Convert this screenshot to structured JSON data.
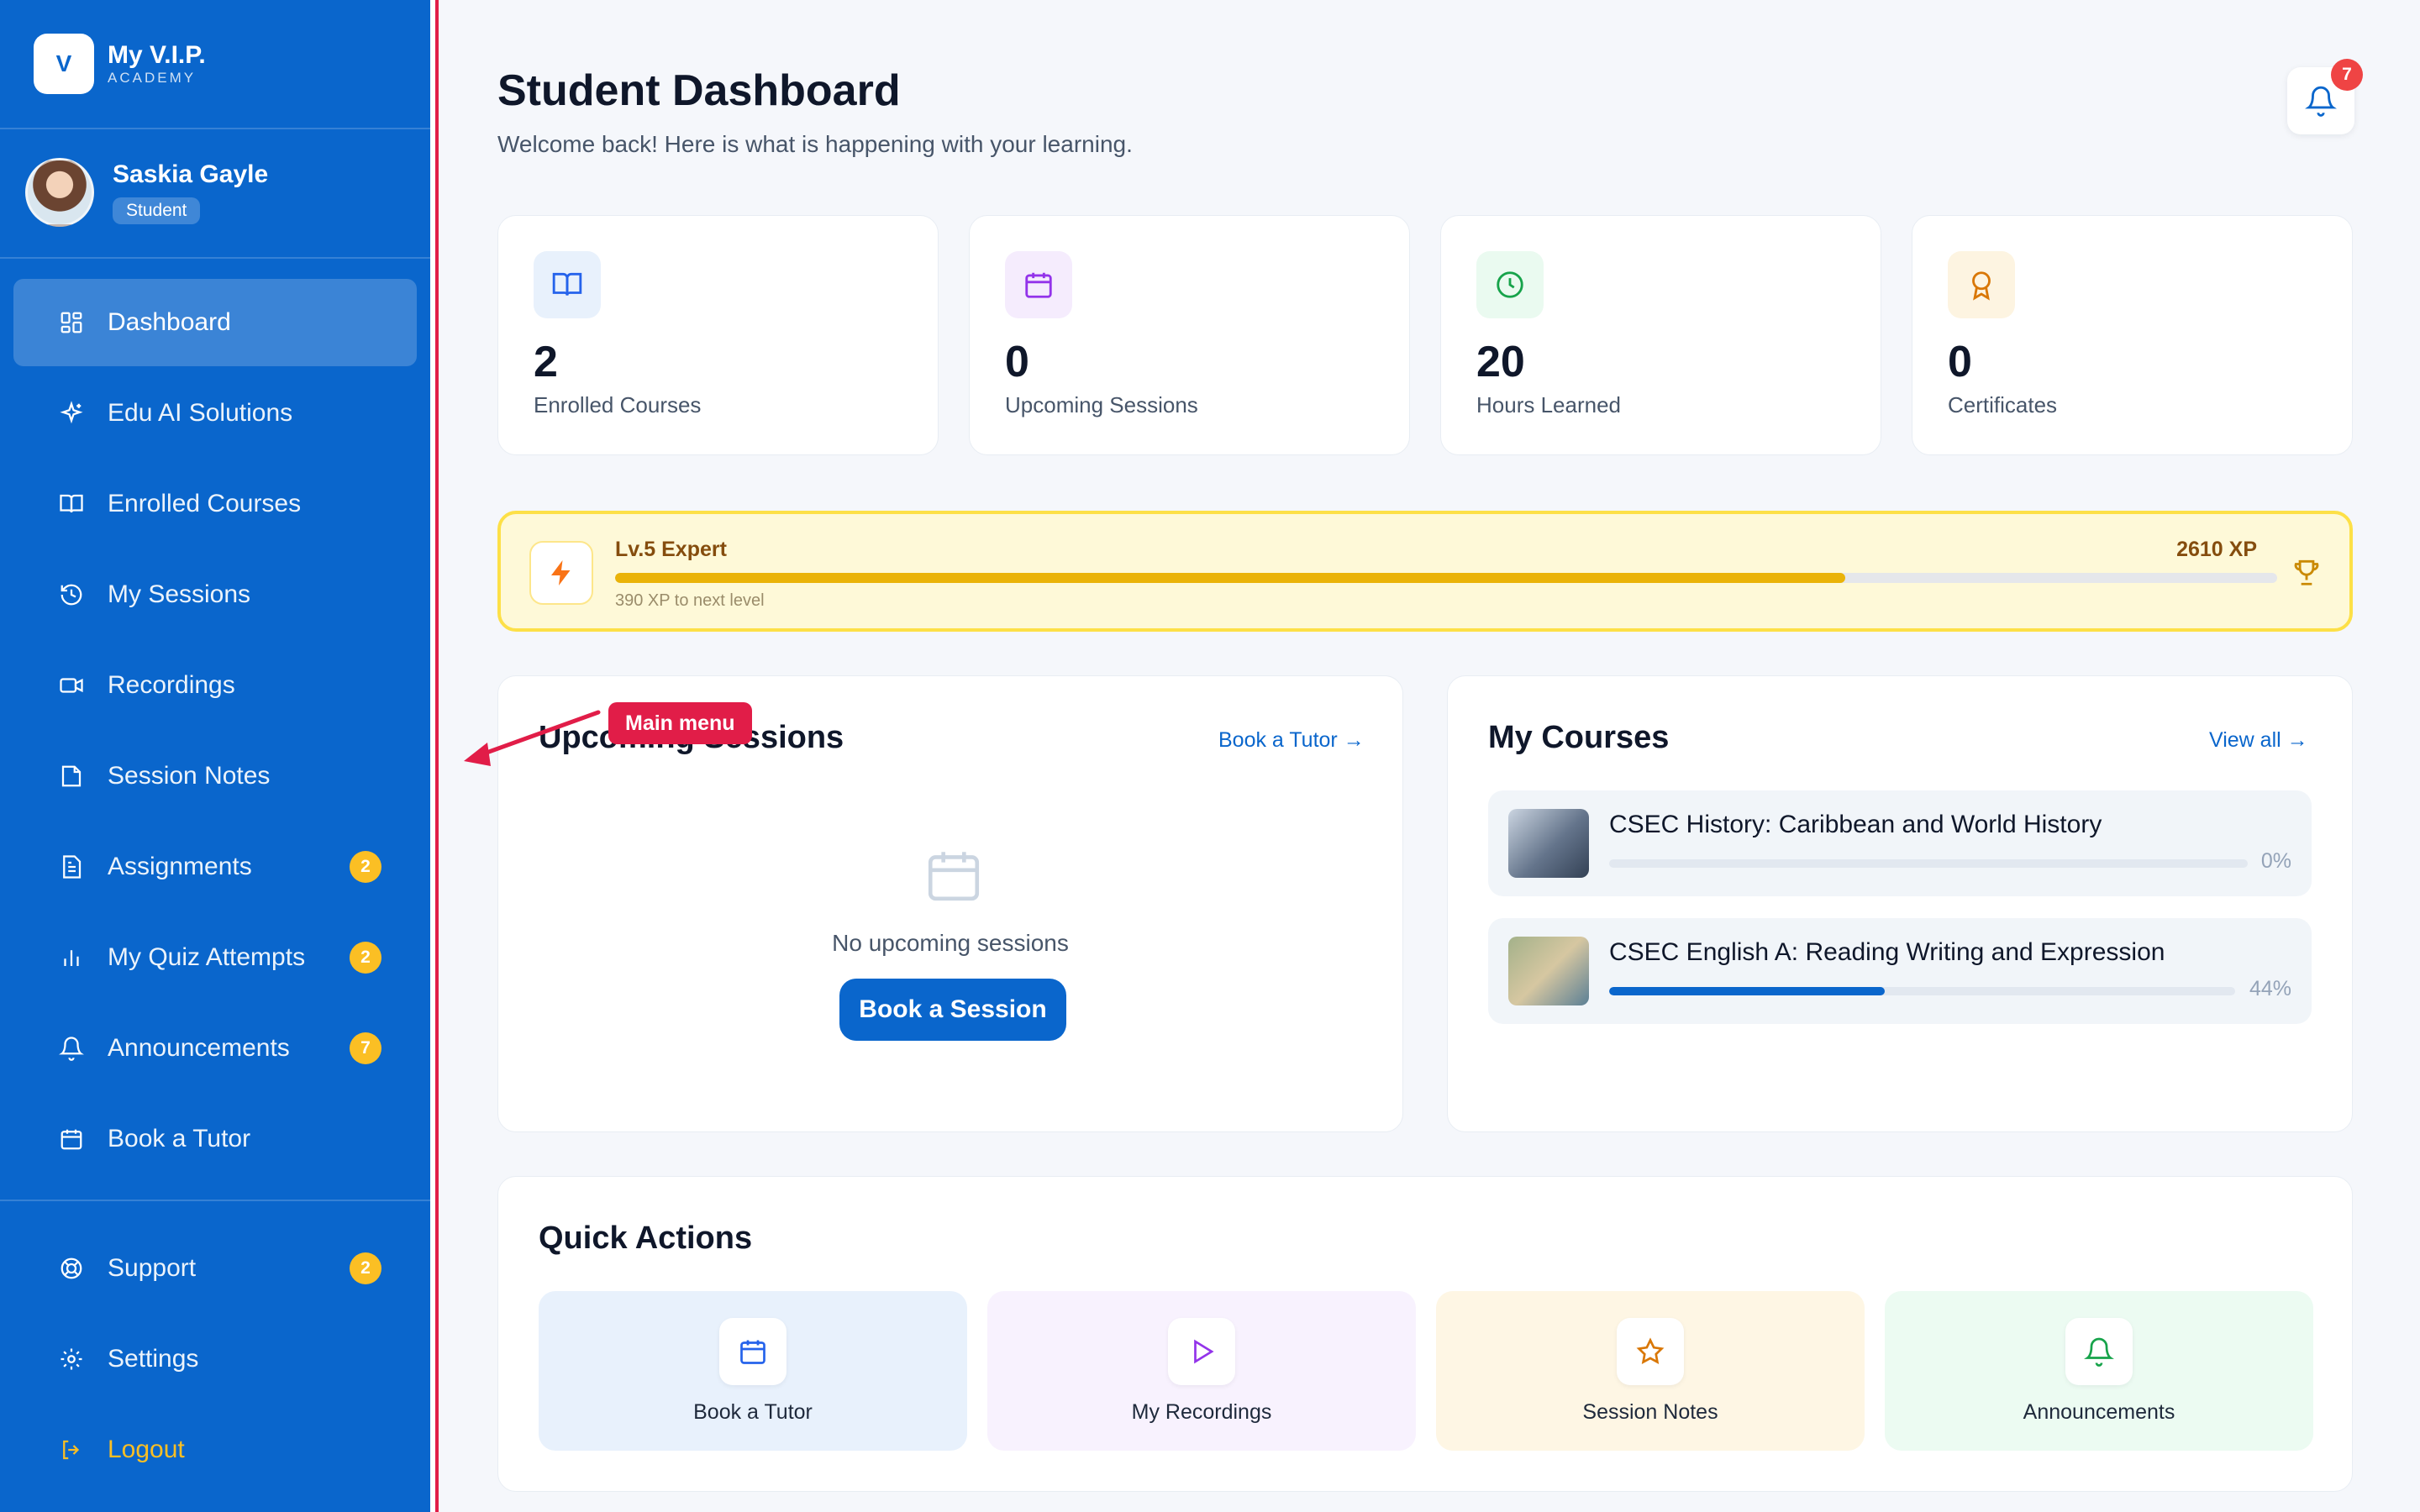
{
  "brand": {
    "logo_letter": "V",
    "name": "My V.I.P.",
    "sub": "ACADEMY"
  },
  "profile": {
    "name": "Saskia Gayle",
    "role": "Student"
  },
  "nav": {
    "items": [
      {
        "label": "Dashboard",
        "icon": "grid-icon",
        "active": true,
        "badge": ""
      },
      {
        "label": "Edu AI Solutions",
        "icon": "sparkle-icon",
        "badge": ""
      },
      {
        "label": "Enrolled Courses",
        "icon": "book-open-icon",
        "badge": ""
      },
      {
        "label": "My Sessions",
        "icon": "history-icon",
        "badge": ""
      },
      {
        "label": "Recordings",
        "icon": "video-icon",
        "badge": ""
      },
      {
        "label": "Session Notes",
        "icon": "note-icon",
        "badge": ""
      },
      {
        "label": "Assignments",
        "icon": "file-text-icon",
        "badge": "2"
      },
      {
        "label": "My Quiz Attempts",
        "icon": "bar-chart-icon",
        "badge": "2"
      },
      {
        "label": "Announcements",
        "icon": "bell-icon",
        "badge": "7"
      },
      {
        "label": "Book a Tutor",
        "icon": "calendar-icon",
        "badge": ""
      }
    ],
    "bottom": [
      {
        "label": "Support",
        "icon": "lifebuoy-icon",
        "badge": "2"
      },
      {
        "label": "Settings",
        "icon": "gear-icon",
        "badge": ""
      },
      {
        "label": "Logout",
        "icon": "logout-icon",
        "badge": ""
      }
    ]
  },
  "header": {
    "title": "Student Dashboard",
    "subtitle": "Welcome back! Here is what is happening with your learning.",
    "notification_count": "7"
  },
  "stats": [
    {
      "value": "2",
      "label": "Enrolled Courses",
      "icon": "book-open-icon",
      "color": "#2563eb",
      "bg": "#e8f1fc"
    },
    {
      "value": "0",
      "label": "Upcoming Sessions",
      "icon": "calendar-icon",
      "color": "#9333ea",
      "bg": "#f5ecfd"
    },
    {
      "value": "20",
      "label": "Hours Learned",
      "icon": "clock-icon",
      "color": "#16a34a",
      "bg": "#eafaf0"
    },
    {
      "value": "0",
      "label": "Certificates",
      "icon": "award-icon",
      "color": "#d97706",
      "bg": "#fdf4e1"
    }
  ],
  "xp": {
    "level": "Lv.5 Expert",
    "total": "2610 XP",
    "next": "390 XP to next level",
    "progress": 0.74
  },
  "upcoming": {
    "title": "Upcoming Sessions",
    "link": "Book a Tutor",
    "empty_text": "No upcoming sessions",
    "button": "Book a Session"
  },
  "courses": {
    "title": "My Courses",
    "link": "View all",
    "items": [
      {
        "title": "CSEC History: Caribbean and World History",
        "percent": "0%",
        "progress": 0
      },
      {
        "title": "CSEC English A: Reading Writing and Expression",
        "percent": "44%",
        "progress": 0.44
      }
    ]
  },
  "quick_actions": {
    "title": "Quick Actions",
    "items": [
      {
        "label": "Book a Tutor",
        "icon": "calendar-icon",
        "bg": "#e8f1fc"
      },
      {
        "label": "My Recordings",
        "icon": "play-icon",
        "bg": "#f8f2fe"
      },
      {
        "label": "Session Notes",
        "icon": "star-icon",
        "bg": "#fef6e4"
      },
      {
        "label": "Announcements",
        "icon": "bell-icon",
        "bg": "#ecfbf2"
      }
    ]
  },
  "annotation": {
    "label": "Main menu"
  }
}
